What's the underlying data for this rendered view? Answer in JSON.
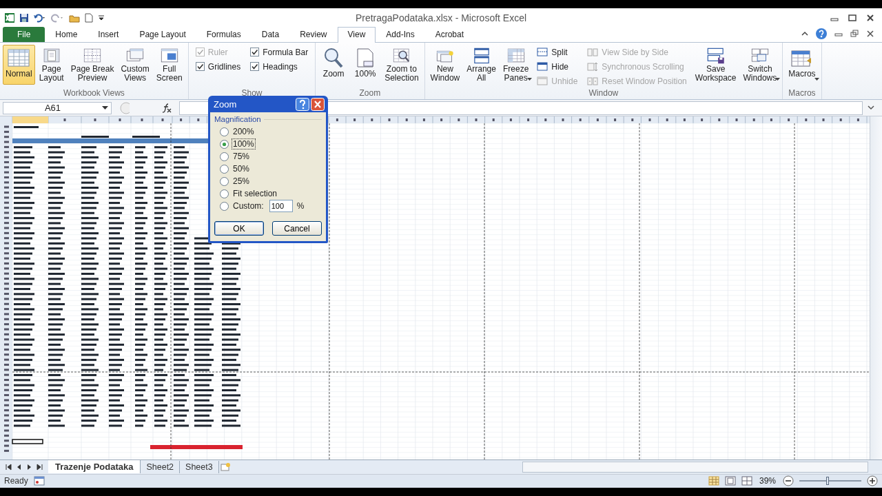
{
  "window": {
    "title": "PretragaPodataka.xlsx  -  Microsoft Excel"
  },
  "tabs": [
    {
      "label": "File",
      "kind": "file",
      "selected": false
    },
    {
      "label": "Home",
      "kind": "tab",
      "selected": false
    },
    {
      "label": "Insert",
      "kind": "tab",
      "selected": false
    },
    {
      "label": "Page Layout",
      "kind": "tab",
      "selected": false
    },
    {
      "label": "Formulas",
      "kind": "tab",
      "selected": false
    },
    {
      "label": "Data",
      "kind": "tab",
      "selected": false
    },
    {
      "label": "Review",
      "kind": "tab",
      "selected": false
    },
    {
      "label": "View",
      "kind": "tab",
      "selected": true
    },
    {
      "label": "Add-Ins",
      "kind": "tab",
      "selected": false
    },
    {
      "label": "Acrobat",
      "kind": "tab",
      "selected": false
    }
  ],
  "ribbon": {
    "groups": [
      {
        "label": "Workbook Views",
        "items": [
          {
            "kind": "large",
            "label": "Normal",
            "selected": true
          },
          {
            "kind": "large",
            "label": "Page\nLayout",
            "selected": false
          },
          {
            "kind": "large",
            "label": "Page Break\nPreview",
            "selected": false
          },
          {
            "kind": "large",
            "label": "Custom\nViews",
            "selected": false
          },
          {
            "kind": "large",
            "label": "Full\nScreen",
            "selected": false
          }
        ]
      },
      {
        "label": "Show",
        "items": [
          {
            "kind": "column",
            "items": [
              {
                "kind": "check",
                "label": "Ruler",
                "checked": true,
                "disabled": true
              },
              {
                "kind": "check",
                "label": "Gridlines",
                "checked": true,
                "disabled": false
              }
            ]
          },
          {
            "kind": "column",
            "items": [
              {
                "kind": "check",
                "label": "Formula Bar",
                "checked": true,
                "disabled": false
              },
              {
                "kind": "check",
                "label": "Headings",
                "checked": true,
                "disabled": false
              }
            ]
          }
        ]
      },
      {
        "label": "Zoom",
        "items": [
          {
            "kind": "large",
            "label": "Zoom",
            "selected": false
          },
          {
            "kind": "large",
            "label": "100%",
            "selected": false
          },
          {
            "kind": "large",
            "label": "Zoom to\nSelection",
            "selected": false
          }
        ]
      },
      {
        "label": "Window",
        "items": [
          {
            "kind": "large",
            "label": "New\nWindow",
            "selected": false
          },
          {
            "kind": "large",
            "label": "Arrange\nAll",
            "selected": false
          },
          {
            "kind": "large",
            "label": "Freeze\nPanes",
            "dropdown": true,
            "selected": false
          },
          {
            "kind": "column",
            "items": [
              {
                "kind": "small",
                "label": "Split",
                "disabled": false
              },
              {
                "kind": "small",
                "label": "Hide",
                "disabled": false
              },
              {
                "kind": "small",
                "label": "Unhide",
                "disabled": true
              }
            ]
          },
          {
            "kind": "column",
            "items": [
              {
                "kind": "small",
                "label": "View Side by Side",
                "disabled": true
              },
              {
                "kind": "small",
                "label": "Synchronous Scrolling",
                "disabled": true
              },
              {
                "kind": "small",
                "label": "Reset Window Position",
                "disabled": true
              }
            ]
          },
          {
            "kind": "large",
            "label": "Save\nWorkspace",
            "selected": false
          },
          {
            "kind": "large",
            "label": "Switch\nWindows",
            "dropdown": true,
            "selected": false
          }
        ]
      },
      {
        "label": "Macros",
        "items": [
          {
            "kind": "large",
            "label": "Macros\n",
            "dropdown": true,
            "selected": false
          }
        ]
      }
    ]
  },
  "formula_bar": {
    "name_box": "A61"
  },
  "dialog": {
    "title": "Zoom",
    "legend": "Magnification",
    "options": [
      {
        "label": "200%",
        "selected": false
      },
      {
        "label": "100%",
        "selected": true
      },
      {
        "label": "75%",
        "selected": false
      },
      {
        "label": "50%",
        "selected": false
      },
      {
        "label": "25%",
        "selected": false
      },
      {
        "label": "Fit selection",
        "selected": false
      },
      {
        "label": "Custom:",
        "selected": false
      }
    ],
    "custom_value": "100",
    "custom_unit": "%",
    "buttons": [
      {
        "label": "OK",
        "default": true
      },
      {
        "label": "Cancel",
        "default": false
      }
    ]
  },
  "sheet_tabs": [
    {
      "label": "Trazenje Podataka",
      "selected": true
    },
    {
      "label": "Sheet2",
      "selected": false
    },
    {
      "label": "Sheet3",
      "selected": false
    }
  ],
  "status_bar": {
    "text": "Ready",
    "zoom": "39%",
    "zoom_slider": {
      "level": 0.45
    }
  }
}
